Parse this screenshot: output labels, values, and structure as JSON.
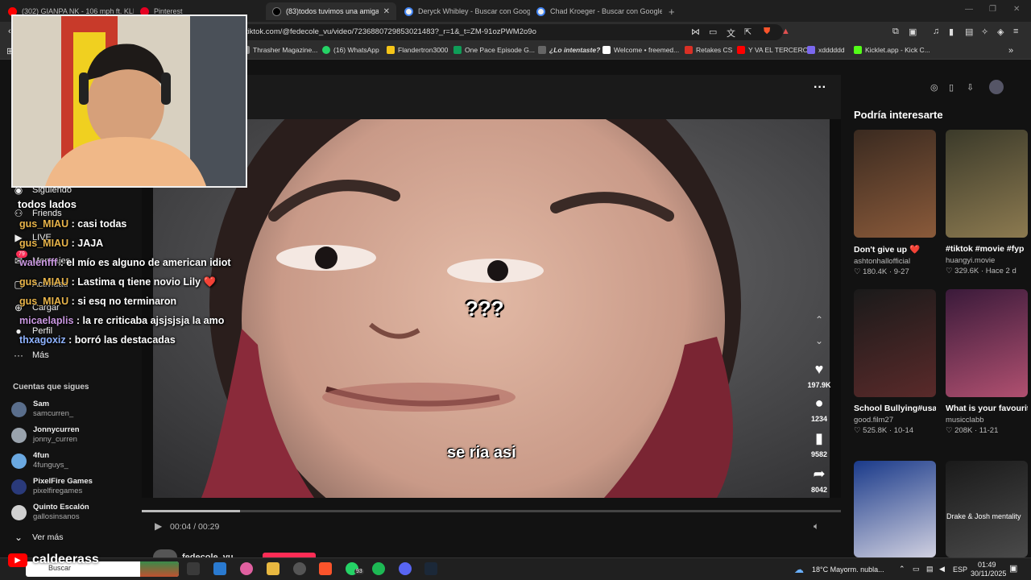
{
  "tabs": [
    {
      "label": "(302) GIANPA NK - 106 mph ft. KLD",
      "color": "#ff0000"
    },
    {
      "label": "Pinterest",
      "color": "#e60023"
    },
    {
      "label": "(83)todos tuvimos una amiga as",
      "color": "#000000",
      "active": true
    },
    {
      "label": "Deryck Whibley - Buscar con Google",
      "color": "#4285f4"
    },
    {
      "label": "Chad Kroeger - Buscar con Google",
      "color": "#4285f4"
    }
  ],
  "address": {
    "url": "tiktok.com/@fedecole_vu/video/7236880729853021483?_r=1&_t=ZM-91ozPWM2o9o"
  },
  "bookmarks": [
    {
      "label": "Thrasher Magazine...",
      "color": "#888888"
    },
    {
      "label": "(16) WhatsApp",
      "color": "#25d366"
    },
    {
      "label": "Flandertron3000",
      "color": "#f5c518"
    },
    {
      "label": "One Pace Episode G...",
      "color": "#0f9d58"
    },
    {
      "label": "¿Lo intentaste?",
      "color": "#666666"
    },
    {
      "label": "Welcome • freemed...",
      "color": "#ffffff"
    },
    {
      "label": "Retakes CS",
      "color": "#d93025"
    },
    {
      "label": "Y VA EL TERCERO",
      "color": "#ff0000"
    },
    {
      "label": "xdddddd",
      "color": "#7b68ee"
    },
    {
      "label": "Kicklet.app - Kick C...",
      "color": "#53fc18"
    }
  ],
  "sidebar": {
    "nav": [
      {
        "label": "Siguiendo",
        "icon": "following-icon"
      },
      {
        "label": "Friends",
        "icon": "friends-icon"
      },
      {
        "label": "LIVE",
        "icon": "live-icon"
      },
      {
        "label": "Mensajes",
        "icon": "messages-icon",
        "badge": "79"
      },
      {
        "label": "Actividad",
        "icon": "activity-icon"
      },
      {
        "label": "Cargar",
        "icon": "upload-icon"
      },
      {
        "label": "Perfil",
        "icon": "profile-icon"
      },
      {
        "label": "Más",
        "icon": "more-icon"
      }
    ],
    "following_title": "Cuentas que sigues",
    "accounts": [
      {
        "name": "Sam",
        "handle": "samcurren_",
        "color": "#5a6e8c"
      },
      {
        "name": "Jonnycurren",
        "handle": "jonny_curren",
        "color": "#9aa3ad"
      },
      {
        "name": "4fun",
        "handle": "4funguys_",
        "color": "#6aa8e0"
      },
      {
        "name": "PixelFire Games",
        "handle": "pixelfiregames",
        "color": "#2a3a7a"
      },
      {
        "name": "Quinto Escalón",
        "handle": "gallosinsanos",
        "color": "#d0d0d0"
      }
    ],
    "see_more": "Ver más"
  },
  "chat": {
    "header": "todos lados",
    "messages": [
      {
        "user": "gus_MIAU",
        "text": ": casi todas",
        "color": "#e8b44a"
      },
      {
        "user": "gus_MIAU",
        "text": ": JAJA",
        "color": "#e8b44a"
      },
      {
        "user": "walenfff",
        "text": ": el mío es alguno de american idiot",
        "color": "#c997e0"
      },
      {
        "user": "gus_MIAU",
        "text": ": Lastima q tiene novio Lily ❤️",
        "color": "#e8b44a"
      },
      {
        "user": "gus_MIAU",
        "text": ": si esq no terminaron",
        "color": "#e8b44a"
      },
      {
        "user": "micaelaplis",
        "text": ": la re criticaba ajsjsjsja la amo",
        "color": "#c997e0"
      },
      {
        "user": "thxagoxiz",
        "text": ": borró las destacadas",
        "color": "#8fb3ff"
      }
    ]
  },
  "stream": {
    "channel": "caldeerass"
  },
  "video": {
    "caption": "se ria asi",
    "overlay_text": "???",
    "time": "00:04 / 00:29",
    "progress": 0.14,
    "author": "fedecole_vu",
    "actions": {
      "likes": "197.9K",
      "comments": "1234",
      "saves": "9582",
      "shares": "8042"
    }
  },
  "recommended": {
    "title": "Podría interesarte",
    "items": [
      {
        "title": "Don't give up ❤️",
        "author": "ashtonhallofficial",
        "stats": "180.4K · 9-27",
        "bg1": "#3a2a20",
        "bg2": "#8a5a3a"
      },
      {
        "title": "#tiktok #movie #fyp",
        "author": "huangyi.movie",
        "stats": "329.6K · Hace 2 d",
        "bg1": "#3b3a2a",
        "bg2": "#8c7a50"
      },
      {
        "title": "School Bullying#usa#movi...",
        "author": "good.film27",
        "stats": "525.8K · 10-14",
        "bg1": "#1a1a1a",
        "bg2": "#5a2a2a"
      },
      {
        "title": "What is your favourite song of...",
        "author": "musicclabb",
        "stats": "208K · 11-21",
        "bg1": "#3a1a3a",
        "bg2": "#b05070"
      },
      {
        "title": "",
        "author": "",
        "stats": "",
        "bg1": "#1a3a8a",
        "bg2": "#d0d0e0"
      },
      {
        "title": "",
        "author": "",
        "stats": "",
        "bg1": "#1a1a1a",
        "bg2": "#4a4a4a",
        "overlay": "Drake & Josh mentality"
      }
    ]
  },
  "taskbar": {
    "search": "Buscar",
    "weather": "18°C  Mayorm. nubla...",
    "lang": "ESP",
    "time": "01:49",
    "date": "30/11/2025",
    "whatsapp_badge": "93"
  }
}
